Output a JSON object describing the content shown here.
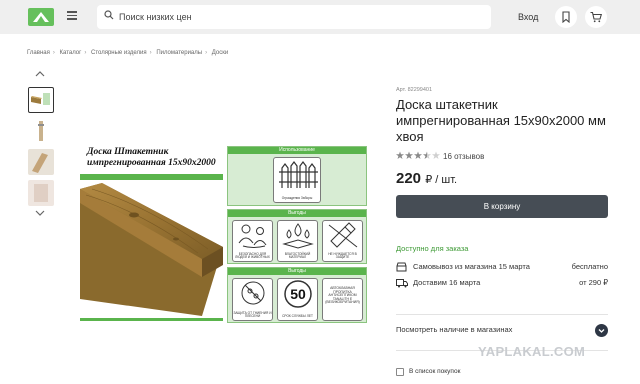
{
  "header": {
    "search_placeholder": "Поиск низких цен",
    "login_label": "Вход"
  },
  "breadcrumb": [
    "Главная",
    "Каталог",
    "Столярные изделия",
    "Пиломатериалы",
    "Доски"
  ],
  "image": {
    "title_line1": "Доска Штакетник",
    "title_line2": "импрегнированная 15х90х2000",
    "panel_usage": {
      "heading": "Использование",
      "caption": "Ограждения Заборы"
    },
    "panel_benefits": {
      "heading": "Выгоды",
      "items": [
        "БЕЗОПАСНО ДЛЯ ЛЮДЕЙ И ЖИВОТНЫХ",
        "ВЛАГОСТОЙКИЙ МАТЕРИАЛ",
        "НЕ НУЖДАЕТСЯ В ЗАЩИТЕ"
      ]
    },
    "panel_benefits2": {
      "heading": "Выгоды",
      "items": [
        "ЗАЩИТА ОТ ГНИЕНИЯ И ПЛЕСЕНИ",
        "СРОК СЛУЖБЫ ЛЕТ",
        "АВТОКЛАВНАЯ ПРОПИТКА АНТИСЕПТИКОМ TANALITH E (ВЕЛИКОБРИТАНИЯ)"
      ],
      "big_number": "50"
    }
  },
  "product": {
    "article": "Арт. 82299401",
    "title": "Доска штакетник импрегнированная 15х90х2000 мм хвоя",
    "rating": 3.5,
    "reviews": "16 отзывов",
    "price": "220",
    "price_unit": "₽ / шт.",
    "cart_button": "В корзину",
    "availability": "Доступно для заказа",
    "pickup_label": "Самовывоз из магазина 15 марта",
    "pickup_value": "бесплатно",
    "delivery_label": "Доставим 16 марта",
    "delivery_value": "от 290 ₽",
    "stores_label": "Посмотреть наличие в магазинах",
    "shopping_list_label": "В список покупок"
  },
  "watermark": "YAPLAKAL.COM",
  "colors": {
    "brand_green": "#66c05c",
    "button_dark": "#464d55",
    "availability_green": "#3d9a35"
  }
}
